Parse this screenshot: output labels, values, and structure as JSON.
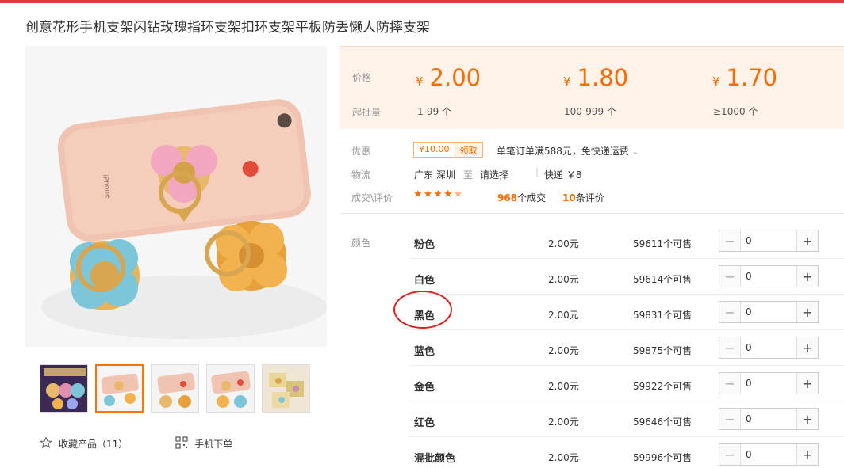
{
  "title": "创意花形手机支架闪钻玫瑰指环支架扣环支架平板防丢懒人防摔支架",
  "price_panel": {
    "price_label": "价格",
    "moq_label": "起批量",
    "currency": "¥",
    "tiers": [
      {
        "price": "2.00",
        "moq": "1-99 个"
      },
      {
        "price": "1.80",
        "moq": "100-999 个"
      },
      {
        "price": "1.70",
        "moq": "≥1000 个"
      }
    ]
  },
  "promo": {
    "label": "优惠",
    "coupon_amount": "¥10.00",
    "coupon_button": "领取",
    "text": "单笔订单满588元，免快递运费"
  },
  "logistics": {
    "label": "物流",
    "from": "广东 深圳",
    "to_word": "至",
    "to_select": "请选择",
    "shipping": "快递 ￥8"
  },
  "reviews": {
    "label": "成交\\评价",
    "rating": 4.5,
    "deals_count": "968",
    "deals_suffix": "个成交",
    "review_count": "10",
    "review_suffix": "条评价"
  },
  "sku": {
    "label": "颜色",
    "rows": [
      {
        "name": "粉色",
        "price": "2.00元",
        "stock": "59611个可售",
        "qty": "0"
      },
      {
        "name": "白色",
        "price": "2.00元",
        "stock": "59614个可售",
        "qty": "0"
      },
      {
        "name": "黑色",
        "price": "2.00元",
        "stock": "59831个可售",
        "qty": "0"
      },
      {
        "name": "蓝色",
        "price": "2.00元",
        "stock": "59875个可售",
        "qty": "0"
      },
      {
        "name": "金色",
        "price": "2.00元",
        "stock": "59922个可售",
        "qty": "0"
      },
      {
        "name": "红色",
        "price": "2.00元",
        "stock": "59646个可售",
        "qty": "0"
      },
      {
        "name": "混批颜色",
        "price": "2.00元",
        "stock": "59996个可售",
        "qty": "0"
      }
    ]
  },
  "actions": {
    "favorite": "收藏产品（11）",
    "mobile_order": "手机下单"
  },
  "colors": {
    "accent": "#ff6a00",
    "brand_red": "#e4393c",
    "price_bg": "#fff2e8"
  }
}
